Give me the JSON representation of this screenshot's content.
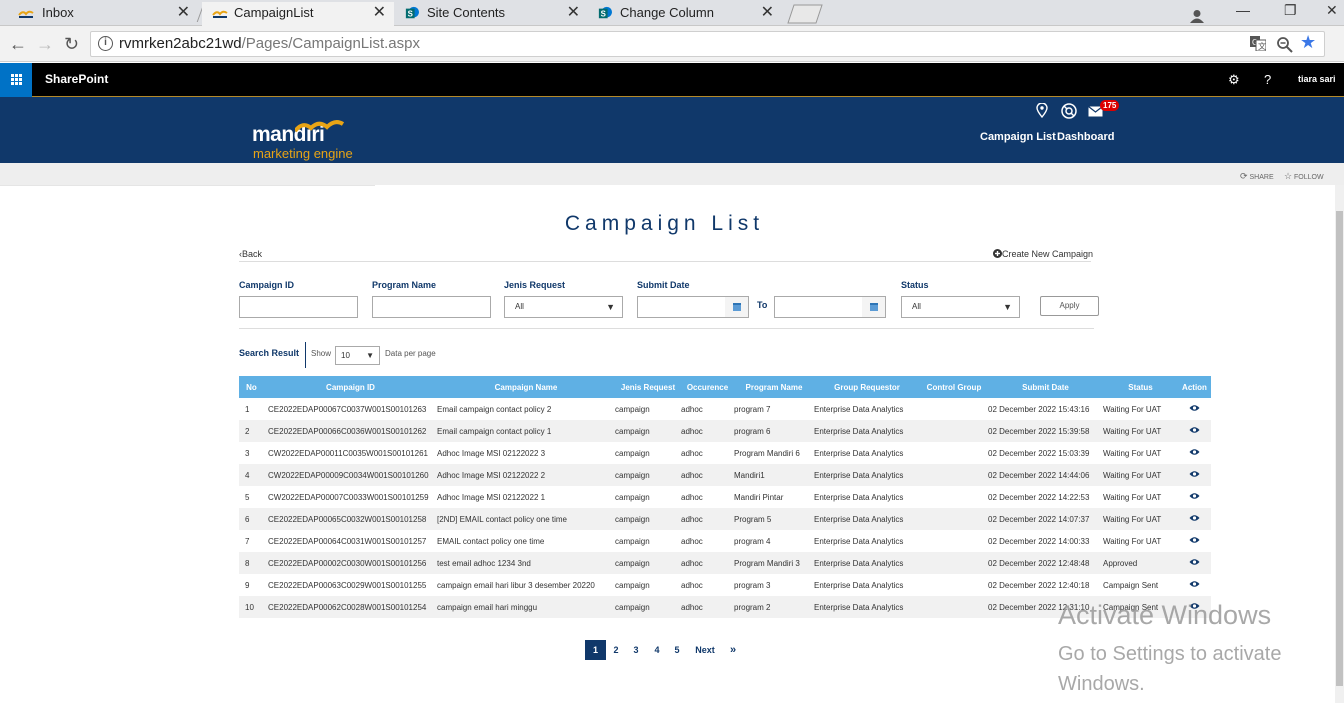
{
  "browser": {
    "tabs": [
      {
        "label": "Inbox"
      },
      {
        "label": "CampaignList"
      },
      {
        "label": "Site Contents"
      },
      {
        "label": "Change Column"
      }
    ],
    "url_host": "rvmrken2abc21wd",
    "url_path": "/Pages/CampaignList.aspx"
  },
  "suitebar": {
    "brand": "SharePoint",
    "help": "?",
    "user": "tiara sari"
  },
  "header": {
    "logo_main": "mandiri",
    "logo_sub": "marketing engine",
    "notification_count": "175",
    "nav": [
      "Campaign List",
      "Dashboard"
    ],
    "share": "SHARE",
    "follow": "FOLLOW"
  },
  "page": {
    "title": "Campaign List",
    "back": "Back",
    "create": "Create New Campaign"
  },
  "filters": {
    "campaign_id_label": "Campaign ID",
    "program_name_label": "Program Name",
    "jenis_request_label": "Jenis Request",
    "jenis_request_value": "All",
    "submit_date_label": "Submit Date",
    "to_label": "To",
    "status_label": "Status",
    "status_value": "All",
    "apply": "Apply"
  },
  "results": {
    "label": "Search Result",
    "show": "Show",
    "per_page_value": "10",
    "per_page_label": "Data per page"
  },
  "table": {
    "headers": [
      "No",
      "Campaign ID",
      "Campaign Name",
      "Jenis Request",
      "Occurence",
      "Program Name",
      "Group Requestor",
      "Control Group",
      "Submit Date",
      "Status",
      "Action"
    ],
    "rows": [
      {
        "no": "1",
        "id": "CE2022EDAP00067C0037W001S00101263",
        "name": "Email campaign contact policy 2",
        "jenis": "campaign",
        "occ": "adhoc",
        "program": "program 7",
        "group": "Enterprise Data Analytics",
        "control": "",
        "date": "02 December 2022 15:43:16",
        "status": "Waiting For UAT"
      },
      {
        "no": "2",
        "id": "CE2022EDAP00066C0036W001S00101262",
        "name": "Email campaign contact policy 1",
        "jenis": "campaign",
        "occ": "adhoc",
        "program": "program 6",
        "group": "Enterprise Data Analytics",
        "control": "",
        "date": "02 December 2022 15:39:58",
        "status": "Waiting For UAT"
      },
      {
        "no": "3",
        "id": "CW2022EDAP00011C0035W001S00101261",
        "name": "Adhoc Image MSI 02122022 3",
        "jenis": "campaign",
        "occ": "adhoc",
        "program": "Program Mandiri 6",
        "group": "Enterprise Data Analytics",
        "control": "",
        "date": "02 December 2022 15:03:39",
        "status": "Waiting For UAT"
      },
      {
        "no": "4",
        "id": "CW2022EDAP00009C0034W001S00101260",
        "name": "Adhoc Image MSI 02122022 2",
        "jenis": "campaign",
        "occ": "adhoc",
        "program": "Mandiri1",
        "group": "Enterprise Data Analytics",
        "control": "",
        "date": "02 December 2022 14:44:06",
        "status": "Waiting For UAT"
      },
      {
        "no": "5",
        "id": "CW2022EDAP00007C0033W001S00101259",
        "name": "Adhoc Image MSI 02122022 1",
        "jenis": "campaign",
        "occ": "adhoc",
        "program": "Mandiri Pintar",
        "group": "Enterprise Data Analytics",
        "control": "",
        "date": "02 December 2022 14:22:53",
        "status": "Waiting For UAT"
      },
      {
        "no": "6",
        "id": "CE2022EDAP00065C0032W001S00101258",
        "name": "[2ND] EMAIL contact policy one time",
        "jenis": "campaign",
        "occ": "adhoc",
        "program": "Program 5",
        "group": "Enterprise Data Analytics",
        "control": "",
        "date": "02 December 2022 14:07:37",
        "status": "Waiting For UAT"
      },
      {
        "no": "7",
        "id": "CE2022EDAP00064C0031W001S00101257",
        "name": "EMAIL contact policy one time",
        "jenis": "campaign",
        "occ": "adhoc",
        "program": "program 4",
        "group": "Enterprise Data Analytics",
        "control": "",
        "date": "02 December 2022 14:00:33",
        "status": "Waiting For UAT"
      },
      {
        "no": "8",
        "id": "CE2022EDAP00002C0030W001S00101256",
        "name": "test email adhoc 1234 3nd",
        "jenis": "campaign",
        "occ": "adhoc",
        "program": "Program Mandiri 3",
        "group": "Enterprise Data Analytics",
        "control": "",
        "date": "02 December 2022 12:48:48",
        "status": "Approved"
      },
      {
        "no": "9",
        "id": "CE2022EDAP00063C0029W001S00101255",
        "name": "campaign email hari libur 3 desember 20220",
        "jenis": "campaign",
        "occ": "adhoc",
        "program": "program 3",
        "group": "Enterprise Data Analytics",
        "control": "",
        "date": "02 December 2022 12:40:18",
        "status": "Campaign Sent"
      },
      {
        "no": "10",
        "id": "CE2022EDAP00062C0028W001S00101254",
        "name": "campaign email hari minggu",
        "jenis": "campaign",
        "occ": "adhoc",
        "program": "program 2",
        "group": "Enterprise Data Analytics",
        "control": "",
        "date": "02 December 2022 12:31:10",
        "status": "Campaign Sent"
      }
    ]
  },
  "pagination": {
    "pages": [
      "1",
      "2",
      "3",
      "4",
      "5"
    ],
    "next": "Next",
    "last": "»"
  },
  "watermark": {
    "line1": "Activate Windows",
    "line2": "Go to Settings to activate Windows."
  },
  "colors": {
    "navy": "#10386a",
    "table_header": "#5fb0e4",
    "sp_blue": "#0072c6",
    "accent_gold": "#e8a415"
  }
}
